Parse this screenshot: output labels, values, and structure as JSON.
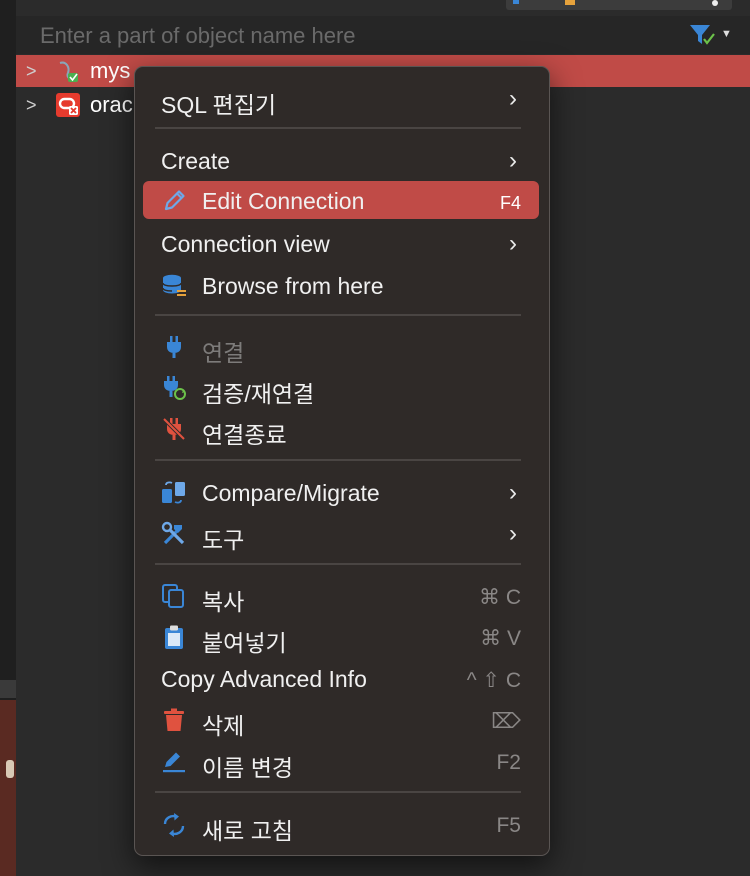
{
  "filter": {
    "placeholder": "Enter a part of object name here"
  },
  "tree": [
    {
      "label": "mys",
      "selected": true,
      "icon": "mysql-db-icon"
    },
    {
      "label": "orac",
      "selected": false,
      "icon": "oracle-db-icon"
    }
  ],
  "menu": {
    "items": [
      {
        "id": "sql-editor",
        "label": "SQL 편집기",
        "submenu": true
      },
      {
        "id": "create",
        "label": "Create",
        "submenu": true
      },
      {
        "id": "edit-connection",
        "label": "Edit Connection",
        "shortcut": "F4",
        "icon": "pencil-icon",
        "highlighted": true
      },
      {
        "id": "connection-view",
        "label": "Connection view",
        "submenu": true
      },
      {
        "id": "browse-from-here",
        "label": "Browse from here",
        "icon": "database-icon"
      },
      {
        "id": "connect",
        "label": "연결",
        "icon": "plug-icon",
        "disabled": true
      },
      {
        "id": "validate-reconnect",
        "label": "검증/재연결",
        "icon": "plug-refresh-icon"
      },
      {
        "id": "disconnect",
        "label": "연결종료",
        "icon": "plug-disconnect-icon"
      },
      {
        "id": "compare-migrate",
        "label": "Compare/Migrate",
        "icon": "compare-icon",
        "submenu": true
      },
      {
        "id": "tools",
        "label": "도구",
        "icon": "tools-icon",
        "submenu": true
      },
      {
        "id": "copy",
        "label": "복사",
        "icon": "copy-icon",
        "shortcut": "⌘ C"
      },
      {
        "id": "paste",
        "label": "붙여넣기",
        "icon": "paste-icon",
        "shortcut": "⌘ V"
      },
      {
        "id": "copy-advanced",
        "label": "Copy Advanced Info",
        "shortcut": "^ ⇧ C"
      },
      {
        "id": "delete",
        "label": "삭제",
        "icon": "trash-icon",
        "shortcut": "⌦"
      },
      {
        "id": "rename",
        "label": "이름 변경",
        "icon": "rename-icon",
        "shortcut": "F2"
      },
      {
        "id": "refresh",
        "label": "새로 고침",
        "icon": "refresh-icon",
        "shortcut": "F5"
      }
    ]
  },
  "colors": {
    "highlight": "#c04b47",
    "menu_bg": "#2f2a28",
    "accent_blue": "#3a86d6"
  }
}
